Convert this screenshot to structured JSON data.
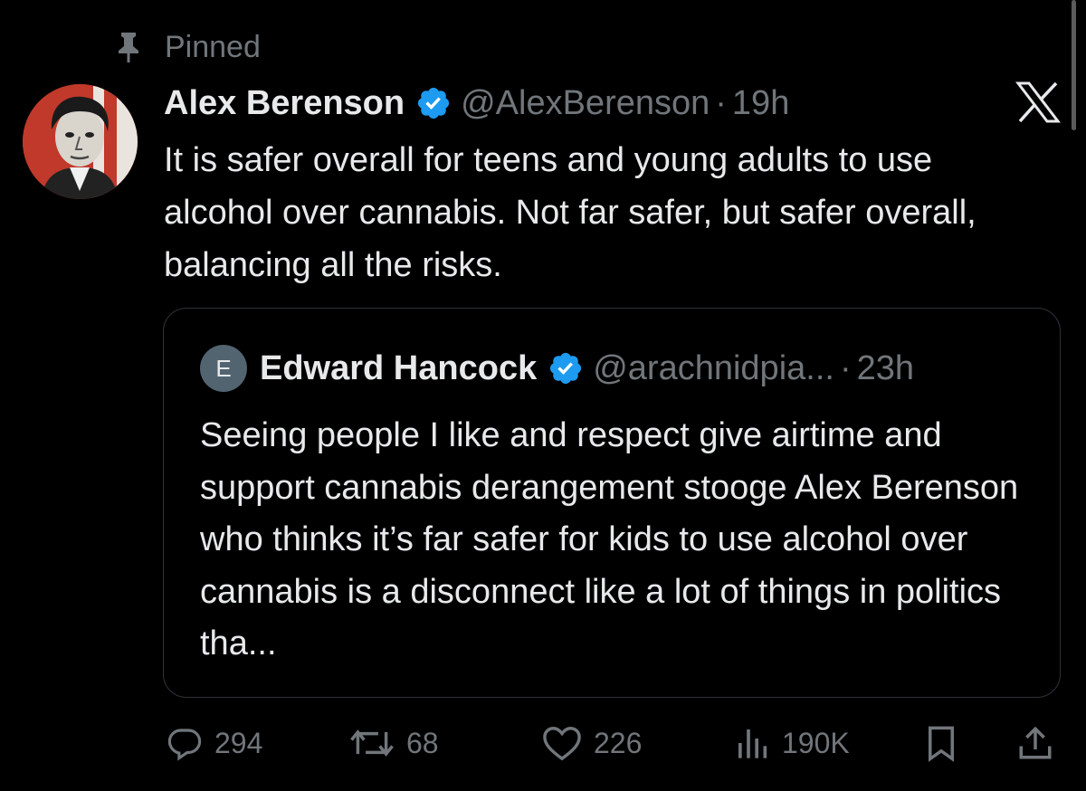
{
  "pinned_label": "Pinned",
  "tweet": {
    "author_name": "Alex Berenson",
    "handle": "@AlexBerenson",
    "separator": "·",
    "time": "19h",
    "text": "It is safer overall for teens and young adults to use alcohol over cannabis. Not far safer, but safer overall, balancing all the risks."
  },
  "quote": {
    "avatar_letter": "E",
    "author_name": "Edward Hancock",
    "handle": "@arachnidpia...",
    "separator": "·",
    "time": "23h",
    "text": "Seeing people I like and respect give airtime and support cannabis derangement stooge Alex Berenson who thinks it’s far safer for kids to use alcohol over cannabis is a disconnect like a lot of things in politics tha..."
  },
  "actions": {
    "replies": "294",
    "reposts": "68",
    "likes": "226",
    "views": "190K"
  },
  "icons": {
    "pin": "pin-icon",
    "verified": "verified-badge-icon",
    "platform": "x-logo-icon",
    "reply": "reply-icon",
    "repost": "repost-icon",
    "like": "heart-icon",
    "views": "views-chart-icon",
    "bookmark": "bookmark-icon",
    "share": "share-icon"
  },
  "colors": {
    "background": "#000000",
    "text": "#e7e9ea",
    "muted": "#71767b",
    "verified": "#1d9bf0",
    "border": "#2f3336"
  }
}
